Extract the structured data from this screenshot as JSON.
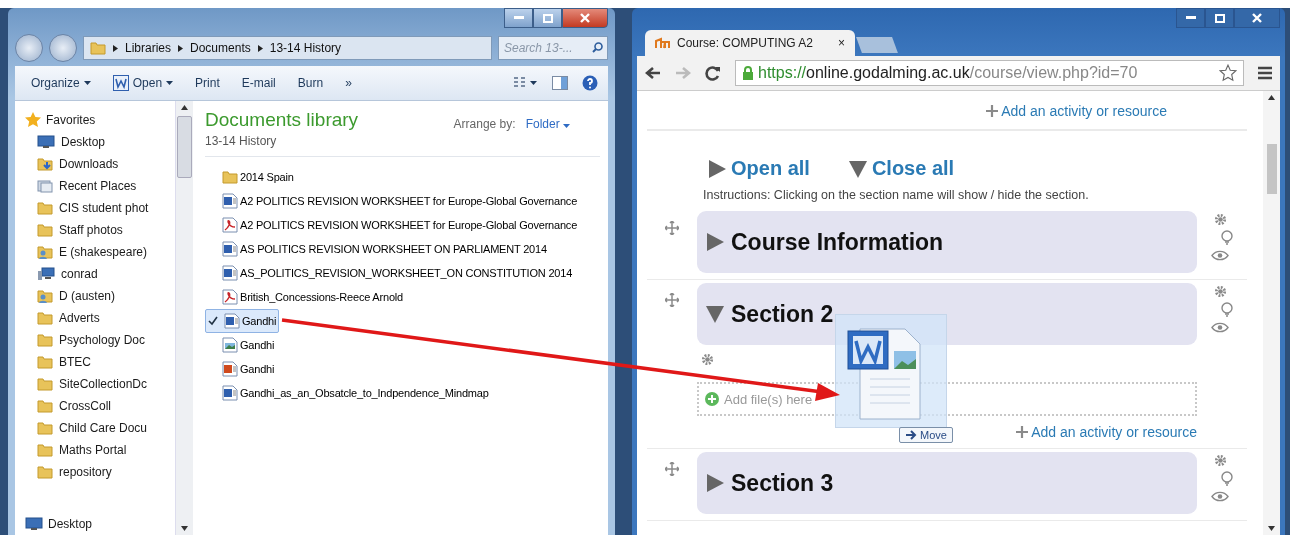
{
  "explorer": {
    "breadcrumb": [
      "Libraries",
      "Documents",
      "13-14 History"
    ],
    "search": {
      "placeholder": "Search 13-..."
    },
    "toolbar": [
      {
        "label": "Organize",
        "kind": "menu"
      },
      {
        "label": "Open",
        "kind": "word-menu"
      },
      {
        "label": "Print",
        "kind": "plain"
      },
      {
        "label": "E-mail",
        "kind": "plain"
      },
      {
        "label": "Burn",
        "kind": "plain"
      },
      {
        "label": "»",
        "kind": "plain"
      }
    ],
    "favorites": {
      "label": "Favorites",
      "items": [
        {
          "label": "Desktop",
          "kind": "desktop"
        },
        {
          "label": "Downloads",
          "kind": "download"
        },
        {
          "label": "Recent Places",
          "kind": "recent"
        },
        {
          "label": "CIS student phot",
          "kind": "folder"
        },
        {
          "label": "Staff photos",
          "kind": "folder"
        },
        {
          "label": "E (shakespeare)",
          "kind": "user"
        },
        {
          "label": "conrad",
          "kind": "network"
        },
        {
          "label": "D (austen)",
          "kind": "user"
        },
        {
          "label": "Adverts",
          "kind": "folder"
        },
        {
          "label": "Psychology Doc",
          "kind": "folder"
        },
        {
          "label": "BTEC",
          "kind": "folder"
        },
        {
          "label": "SiteCollectionDc",
          "kind": "folder"
        },
        {
          "label": "CrossColl",
          "kind": "folder"
        },
        {
          "label": "Child Care Docu",
          "kind": "folder"
        },
        {
          "label": "Maths Portal",
          "kind": "folder"
        },
        {
          "label": "repository",
          "kind": "folder"
        }
      ]
    },
    "nav_bottom": {
      "label": "Desktop",
      "kind": "desktop"
    },
    "library": {
      "title": "Documents library",
      "subtitle": "13-14 History",
      "arrange_label": "Arrange by:",
      "arrange_value": "Folder"
    },
    "files": [
      {
        "name": "2014 Spain",
        "kind": "folder",
        "selected": false
      },
      {
        "name": "A2 POLITICS  REVISION WORKSHEET for Europe-Global Governance",
        "kind": "word",
        "selected": false
      },
      {
        "name": "A2 POLITICS  REVISION WORKSHEET for Europe-Global Governance",
        "kind": "pdf",
        "selected": false
      },
      {
        "name": "AS POLITICS REVISION WORKSHEET ON PARLIAMENT 2014",
        "kind": "word",
        "selected": false
      },
      {
        "name": "AS_POLITICS_REVISION_WORKSHEET_ON CONSTITUTION 2014",
        "kind": "word",
        "selected": false
      },
      {
        "name": "British_Concessions-Reece Arnold",
        "kind": "pdf",
        "selected": false
      },
      {
        "name": "Gandhi",
        "kind": "word",
        "selected": true
      },
      {
        "name": "Gandhi",
        "kind": "image",
        "selected": false
      },
      {
        "name": "Gandhi",
        "kind": "slides",
        "selected": false
      },
      {
        "name": "Gandhi_as_an_Obsatcle_to_Indpendence_Mindmap",
        "kind": "word",
        "selected": false
      }
    ]
  },
  "browser": {
    "tab": {
      "title": "Course: COMPUTING A2",
      "close": "×"
    },
    "url": {
      "scheme": "https://",
      "host": "online.godalming.ac.uk",
      "path": "/course/view.php?id=70"
    },
    "top_link": "Add an activity or resource",
    "open_all": "Open all",
    "close_all": "Close all",
    "instructions": "Instructions: Clicking on the section name will show / hide the section.",
    "sections": [
      {
        "title": "Course Information",
        "expanded": false
      },
      {
        "title": "Section 2",
        "expanded": true,
        "dropzone": "Add file(s) here",
        "add_link": "Add an activity or resource"
      },
      {
        "title": "Section 3",
        "expanded": false
      }
    ]
  },
  "drag": {
    "label": "Move"
  }
}
